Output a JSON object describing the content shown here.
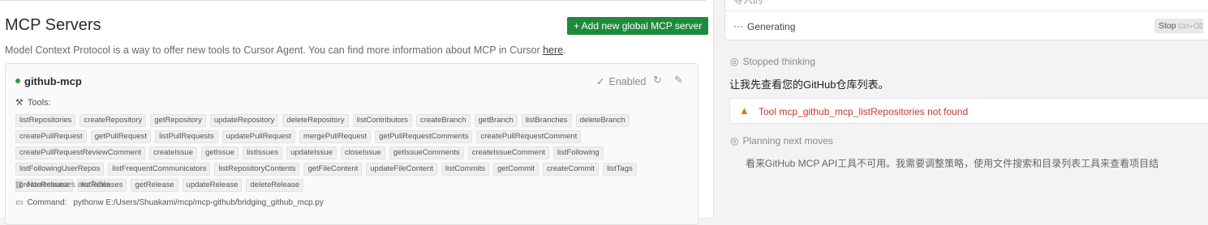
{
  "mcp": {
    "title": "MCP Servers",
    "add_button": "+ Add new global MCP server",
    "description": "Model Context Protocol is a way to offer new tools to Cursor Agent. You can find more information about MCP in Cursor ",
    "description_link": "here",
    "description_end": "."
  },
  "server": {
    "name": "github-mcp",
    "status": "Enabled",
    "tools_label": "Tools:",
    "tools": [
      "listRepositories",
      "createRepository",
      "getRepository",
      "updateRepository",
      "deleteRepository",
      "listContributors",
      "createBranch",
      "getBranch",
      "listBranches",
      "deleteBranch",
      "createPullRequest",
      "getPullRequest",
      "listPullRequests",
      "updatePullRequest",
      "mergePullRequest",
      "getPullRequestComments",
      "createPullRequestComment",
      "createPullRequestReviewComment",
      "createIssue",
      "getIssue",
      "listIssues",
      "updateIssue",
      "closeIssue",
      "getIssueComments",
      "createIssueComment",
      "listFollowing",
      "listFollowingUserRepos",
      "listFrequentCommunicators",
      "listRepositoryContents",
      "getFileContent",
      "updateFileContent",
      "listCommits",
      "getCommit",
      "createCommit",
      "listTags",
      "createRelease",
      "listReleases",
      "getRelease",
      "updateRelease",
      "deleteRelease"
    ],
    "no_resources": "No resources available",
    "command_label": "Command:",
    "command": "pythonw E:/Users/Shuakami/mcp/mcp-github/bridging_github_mcp.py"
  },
  "chat": {
    "top_partial": "导入的",
    "generating": "Generating",
    "stop_label": "Stop",
    "stop_shortcut": "Ctrl+⌫",
    "stopped_thinking": "Stopped thinking",
    "message": "让我先查看您的GitHub仓库列表。",
    "error": "Tool mcp_github_mcp_listRepositories not found",
    "planning": "Planning next moves",
    "plan_text": "看来GitHub MCP API工具不可用。我需要调整策略，使用文件搜索和目录列表工具来查看项目结"
  },
  "colors": {
    "accent_green": "#1f8a3c",
    "error_red": "#c0392b",
    "warning_orange": "#e07b00"
  },
  "icons": [
    "refresh-icon",
    "edit-icon",
    "tools-icon",
    "resources-icon",
    "command-icon",
    "check-icon",
    "brain-icon",
    "warning-icon",
    "dots-icon"
  ]
}
